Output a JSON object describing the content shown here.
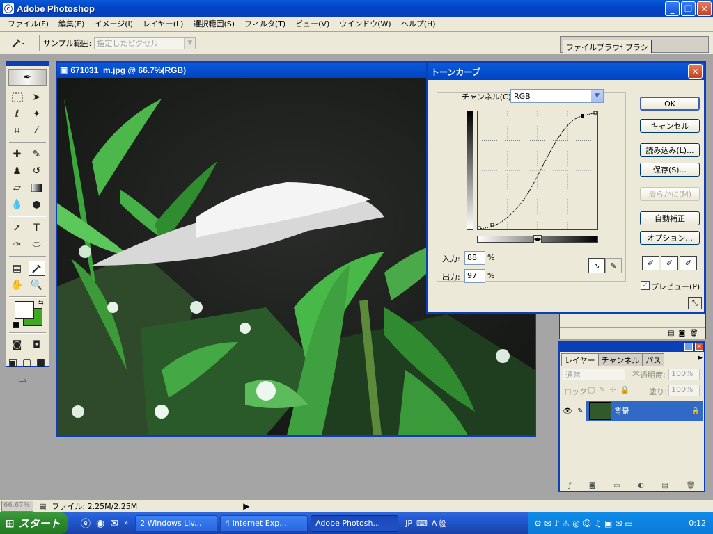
{
  "app": {
    "title": "Adobe Photoshop"
  },
  "menu": [
    "ファイル(F)",
    "編集(E)",
    "イメージ(I)",
    "レイヤー(L)",
    "選択範囲(S)",
    "フィルタ(T)",
    "ビュー(V)",
    "ウインドウ(W)",
    "ヘルプ(H)"
  ],
  "options": {
    "sample_label": "サンプル範囲:",
    "sample_value": "指定したピクセル"
  },
  "palette_well": {
    "tab1": "ファイルブラウザ",
    "tab2": "ブラシ"
  },
  "document": {
    "title": "671031_m.jpg @ 66.7%(RGB)"
  },
  "curves": {
    "title": "トーンカーブ",
    "channel_label": "チャンネル(C):",
    "channel_value": "RGB",
    "input_label": "入力:",
    "input_value": "88",
    "output_label": "出力:",
    "output_value": "97",
    "percent": "%",
    "preview_label": "プレビュー(P)",
    "buttons": {
      "ok": "OK",
      "cancel": "キャンセル",
      "load": "読み込み(L)...",
      "save": "保存(S)...",
      "smooth": "滑らかに(M)",
      "auto": "自動補正",
      "options": "オプション..."
    }
  },
  "layers": {
    "tabs": [
      "レイヤー",
      "チャンネル",
      "パス"
    ],
    "blend_mode": "通常",
    "opacity_label": "不透明度:",
    "opacity_value": "100%",
    "lock_label": "ロック:",
    "fill_label": "塗り:",
    "fill_value": "100%",
    "layer_name": "背景"
  },
  "statusbar": {
    "zoom": "66.67%",
    "file_info": "ファイル: 2.25M/2.25M"
  },
  "taskbar": {
    "start": "スタート",
    "items": [
      "2 Windows Liv...",
      "4 Internet Exp...",
      "Adobe Photosh..."
    ],
    "lang": "JP",
    "ime": "般",
    "clock": "0:12"
  },
  "colors": {
    "foreground": "#ffffff",
    "background": "#3fa81e",
    "accent": "#0a3fb8"
  }
}
